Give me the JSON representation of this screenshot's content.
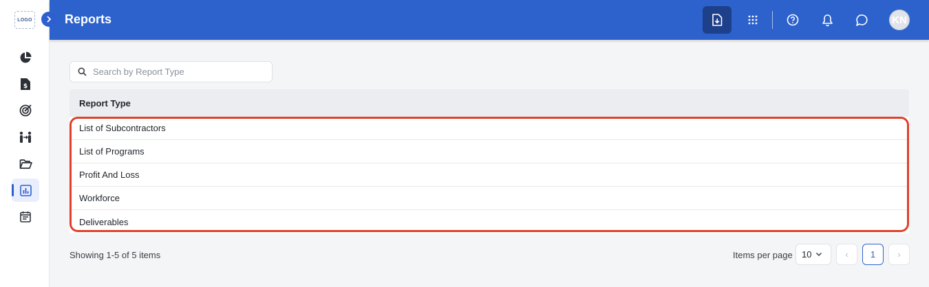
{
  "sidebar": {
    "logo_text": "LOGO",
    "items": [
      {
        "icon": "pie-chart-icon"
      },
      {
        "icon": "invoice-dollar-icon"
      },
      {
        "icon": "target-icon"
      },
      {
        "icon": "people-exchange-icon"
      },
      {
        "icon": "folder-open-icon"
      },
      {
        "icon": "bar-chart-icon",
        "active": true
      },
      {
        "icon": "calendar-list-icon"
      }
    ]
  },
  "header": {
    "title": "Reports",
    "avatar_initials": "KN"
  },
  "search": {
    "placeholder": "Search by Report Type"
  },
  "table": {
    "column_header": "Report Type",
    "rows": [
      {
        "label": "List of Subcontractors"
      },
      {
        "label": "List of Programs"
      },
      {
        "label": "Profit And Loss"
      },
      {
        "label": "Workforce"
      },
      {
        "label": "Deliverables"
      }
    ]
  },
  "footer": {
    "showing_text": "Showing 1-5 of 5 items",
    "items_per_page_label": "Items per page",
    "items_per_page_value": "10",
    "prev_symbol": "‹",
    "current_page": "1",
    "next_symbol": "›"
  },
  "colors": {
    "header_bg": "#2d62cc",
    "active_icon_bg": "#1e3f8a",
    "highlight_border": "#e0402a"
  }
}
